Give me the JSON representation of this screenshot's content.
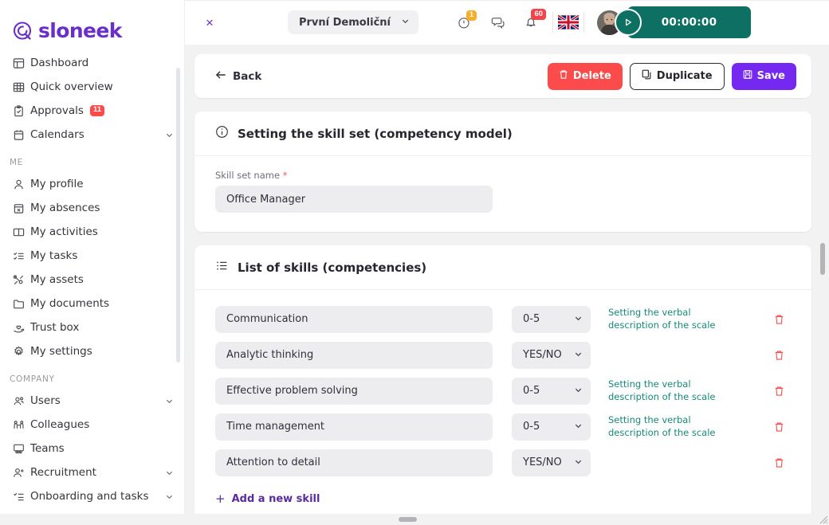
{
  "brand": {
    "name": "sloneek",
    "color": "#6b2fc9"
  },
  "sidebar": {
    "items": [
      {
        "label": "Dashboard",
        "icon": "dashboard-icon"
      },
      {
        "label": "Quick overview",
        "icon": "grid-icon"
      },
      {
        "label": "Approvals",
        "icon": "clipboard-check-icon",
        "badge": "11"
      },
      {
        "label": "Calendars",
        "icon": "calendar-icon",
        "chevron": true
      }
    ],
    "sections": [
      {
        "title": "ME",
        "items": [
          {
            "label": "My profile",
            "icon": "user-icon"
          },
          {
            "label": "My absences",
            "icon": "calendar-x-icon"
          },
          {
            "label": "My activities",
            "icon": "book-open-icon"
          },
          {
            "label": "My tasks",
            "icon": "list-check-icon"
          },
          {
            "label": "My assets",
            "icon": "tools-icon"
          },
          {
            "label": "My documents",
            "icon": "folder-icon"
          },
          {
            "label": "Trust box",
            "icon": "hand-heart-icon"
          },
          {
            "label": "My settings",
            "icon": "gear-icon"
          }
        ]
      },
      {
        "title": "COMPANY",
        "items": [
          {
            "label": "Users",
            "icon": "users-icon",
            "chevron": true
          },
          {
            "label": "Colleagues",
            "icon": "colleagues-icon"
          },
          {
            "label": "Teams",
            "icon": "teams-icon"
          },
          {
            "label": "Recruitment",
            "icon": "user-plus-icon",
            "chevron": true
          },
          {
            "label": "Onboarding and tasks",
            "icon": "onboarding-icon",
            "chevron": true
          }
        ]
      }
    ]
  },
  "topbar": {
    "close_label": "×",
    "company": "První Demoliční",
    "info_badge": "1",
    "notifications_badge": "60",
    "language": "en-GB",
    "timer": "00:00:00"
  },
  "action_bar": {
    "back_label": "Back",
    "delete_label": "Delete",
    "duplicate_label": "Duplicate",
    "save_label": "Save"
  },
  "skillset_card": {
    "title": "Setting the skill set (competency model)",
    "field_label": "Skill set name",
    "required_mark": "*",
    "name_value": "Office Manager"
  },
  "skills_card": {
    "title": "List of skills (competencies)",
    "add_label": "Add a new skill",
    "add_plus": "+",
    "verbal_link_label": "Setting the verbal description of the scale",
    "rows": [
      {
        "name": "Communication",
        "scale": "0-5",
        "has_verbal_link": true
      },
      {
        "name": "Analytic thinking",
        "scale": "YES/NO",
        "has_verbal_link": false
      },
      {
        "name": "Effective problem solving",
        "scale": "0-5",
        "has_verbal_link": true
      },
      {
        "name": "Time management",
        "scale": "0-5",
        "has_verbal_link": true
      },
      {
        "name": "Attention to detail",
        "scale": "YES/NO",
        "has_verbal_link": false
      }
    ]
  },
  "colors": {
    "primary_purple": "#7528f0",
    "brand_purple": "#6b2fc9",
    "danger_red": "#fb4b4b",
    "teal": "#0d7063",
    "link_teal": "#18887a",
    "amber": "#f6ae2d"
  }
}
